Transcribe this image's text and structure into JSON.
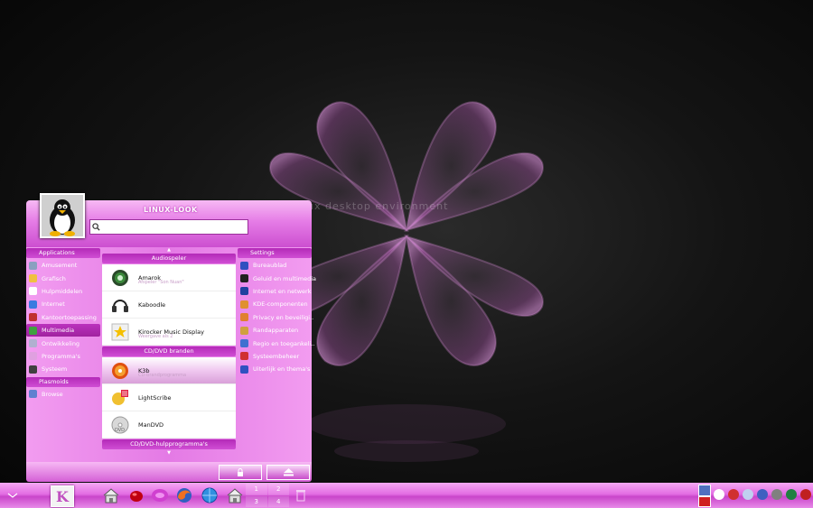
{
  "wallpaper": {
    "text": "ux desktop environment"
  },
  "menu": {
    "title": "LINUX-LOOK",
    "search_placeholder": "",
    "left_column": {
      "applications_header": "Applications",
      "items": [
        {
          "label": "Amusement",
          "icon": "games-icon",
          "color": "#8aa0c0"
        },
        {
          "label": "Grafisch",
          "icon": "graphics-icon",
          "color": "#f0c040"
        },
        {
          "label": "Hulpmiddelen",
          "icon": "utilities-icon",
          "color": "#ffffff"
        },
        {
          "label": "Internet",
          "icon": "internet-icon",
          "color": "#3a7be0"
        },
        {
          "label": "Kantoortoepassing",
          "icon": "office-icon",
          "color": "#c03030"
        },
        {
          "label": "Multimedia",
          "icon": "multimedia-icon",
          "color": "#40a040",
          "active": true
        },
        {
          "label": "Ontwikkeling",
          "icon": "development-icon",
          "color": "#b0b0d0"
        },
        {
          "label": "Programma's",
          "icon": "programs-icon",
          "color": "#e0a0e0"
        },
        {
          "label": "Systeem",
          "icon": "system-icon",
          "color": "#404040"
        }
      ],
      "plasmoids_header": "Plasmoids",
      "plasmoid_items": [
        {
          "label": "Browse",
          "icon": "browse-icon",
          "color": "#6080d0"
        }
      ]
    },
    "center": {
      "section1": "Audiospeler",
      "apps1": [
        {
          "name": "Amarok",
          "sub": "Afspeler \"Son Nuan\"",
          "icon": "amarok-icon"
        },
        {
          "name": "Kaboodle",
          "sub": "",
          "icon": "headphones-icon"
        },
        {
          "name": "Kirocker Music Display",
          "sub": "Weergave als 2",
          "icon": "star-icon"
        }
      ],
      "section2": "CD/DVD branden",
      "apps2": [
        {
          "name": "K3b",
          "sub": "CD-brandprogramma",
          "icon": "k3b-icon",
          "highlight": true
        },
        {
          "name": "LightScribe",
          "sub": "",
          "icon": "lightscribe-icon"
        },
        {
          "name": "ManDVD",
          "sub": "",
          "icon": "dvd-icon"
        }
      ],
      "section3": "CD/DVD-hulpprogramma's"
    },
    "right_column": {
      "header": "Settings",
      "items": [
        {
          "label": "Bureaublad",
          "icon": "desktop-icon",
          "color": "#3050c0"
        },
        {
          "label": "Geluid en multimedia",
          "icon": "sound-icon",
          "color": "#202020"
        },
        {
          "label": "Internet en netwerk",
          "icon": "network-icon",
          "color": "#2040a0"
        },
        {
          "label": "KDE-componenten",
          "icon": "kde-components-icon",
          "color": "#e09030"
        },
        {
          "label": "Privacy en beveiligi..",
          "icon": "privacy-icon",
          "color": "#e08030"
        },
        {
          "label": "Randapparaten",
          "icon": "peripherals-icon",
          "color": "#d0a040"
        },
        {
          "label": "Regio en toegankeli..",
          "icon": "region-icon",
          "color": "#4070d0"
        },
        {
          "label": "Systeembeheer",
          "icon": "admin-icon",
          "color": "#d03030"
        },
        {
          "label": "Uiterlijk en thema's",
          "icon": "appearance-icon",
          "color": "#3050c0"
        }
      ]
    },
    "footer": {
      "lock_icon": "lock-icon",
      "eject_icon": "eject-icon"
    }
  },
  "taskbar": {
    "start_label": "K",
    "pager": [
      "1",
      "2",
      "3",
      "4"
    ]
  }
}
